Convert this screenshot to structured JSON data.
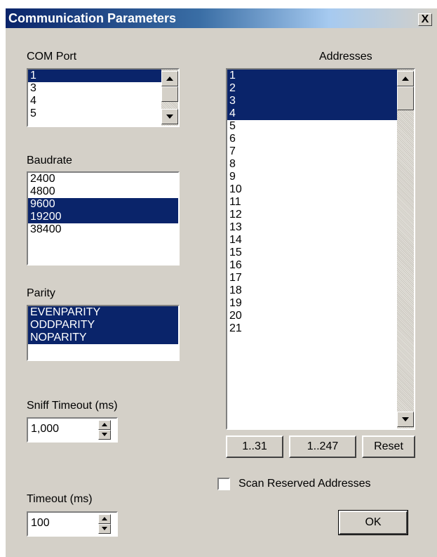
{
  "window": {
    "title": "Communication Parameters",
    "close_glyph": "X"
  },
  "com_port": {
    "label": "COM Port",
    "items": [
      {
        "text": "1",
        "selected": true
      },
      {
        "text": "3",
        "selected": false
      },
      {
        "text": "4",
        "selected": false
      },
      {
        "text": "5",
        "selected": false
      }
    ]
  },
  "baudrate": {
    "label": "Baudrate",
    "items": [
      {
        "text": "2400",
        "selected": false
      },
      {
        "text": "4800",
        "selected": false
      },
      {
        "text": "9600",
        "selected": true
      },
      {
        "text": "19200",
        "selected": true
      },
      {
        "text": "38400",
        "selected": false
      }
    ]
  },
  "parity": {
    "label": "Parity",
    "items": [
      {
        "text": "EVENPARITY",
        "selected": true
      },
      {
        "text": "ODDPARITY",
        "selected": true
      },
      {
        "text": "NOPARITY",
        "selected": true
      }
    ]
  },
  "sniff_timeout": {
    "label": "Sniff Timeout (ms)",
    "value": "1,000"
  },
  "timeout": {
    "label": "Timeout (ms)",
    "value": "100"
  },
  "addresses": {
    "label": "Addresses",
    "items": [
      {
        "text": "1",
        "selected": true
      },
      {
        "text": "2",
        "selected": true
      },
      {
        "text": "3",
        "selected": true
      },
      {
        "text": "4",
        "selected": true
      },
      {
        "text": "5",
        "selected": false
      },
      {
        "text": "6",
        "selected": false
      },
      {
        "text": "7",
        "selected": false
      },
      {
        "text": "8",
        "selected": false
      },
      {
        "text": "9",
        "selected": false
      },
      {
        "text": "10",
        "selected": false
      },
      {
        "text": "11",
        "selected": false
      },
      {
        "text": "12",
        "selected": false
      },
      {
        "text": "13",
        "selected": false
      },
      {
        "text": "14",
        "selected": false
      },
      {
        "text": "15",
        "selected": false
      },
      {
        "text": "16",
        "selected": false
      },
      {
        "text": "17",
        "selected": false
      },
      {
        "text": "18",
        "selected": false
      },
      {
        "text": "19",
        "selected": false
      },
      {
        "text": "20",
        "selected": false
      },
      {
        "text": "21",
        "selected": false
      }
    ]
  },
  "buttons": {
    "range_31": "1..31",
    "range_247": "1..247",
    "reset": "Reset",
    "ok": "OK"
  },
  "scan_reserved": {
    "label": "Scan Reserved Addresses",
    "checked": false
  },
  "colors": {
    "dialog_bg": "#d4d0c8",
    "selection": "#0a246a",
    "title_gradient_start": "#0a246a",
    "title_gradient_end": "#a6caf0"
  },
  "icons": {
    "scroll_up": "arrow-up-icon",
    "scroll_down": "arrow-down-icon",
    "spin_up": "spin-up-icon",
    "spin_down": "spin-down-icon"
  }
}
